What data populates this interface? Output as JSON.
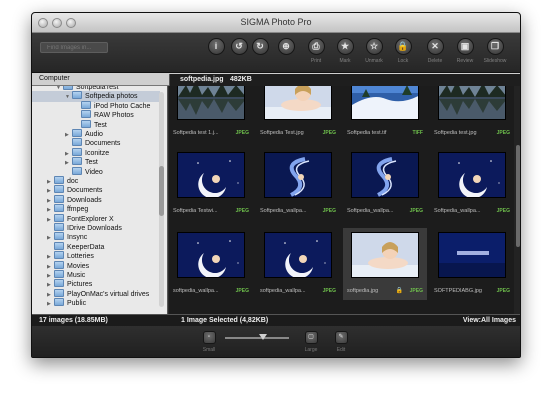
{
  "window": {
    "title": "SIGMA Photo Pro"
  },
  "toolbar": {
    "search_placeholder": "Find Images in...",
    "buttons": [
      {
        "name": "info-button",
        "glyph": "i",
        "label": ""
      },
      {
        "name": "rotate-left-button",
        "glyph": "↺",
        "label": ""
      },
      {
        "name": "rotate-right-button",
        "glyph": "↻",
        "label": ""
      },
      {
        "name": "zoom-button",
        "glyph": "⊕",
        "label": ""
      },
      {
        "name": "print-button",
        "glyph": "⎙",
        "label": "Print"
      },
      {
        "name": "mark-button",
        "glyph": "★",
        "label": "Mark"
      },
      {
        "name": "unmark-button",
        "glyph": "☆",
        "label": "Unmark"
      },
      {
        "name": "lock-button",
        "glyph": "🔒",
        "label": "Lock"
      },
      {
        "name": "delete-button",
        "glyph": "✕",
        "label": "Delete"
      },
      {
        "name": "review-button",
        "glyph": "▣",
        "label": "Review"
      },
      {
        "name": "slideshow-button",
        "glyph": "❐",
        "label": "Slideshow"
      }
    ]
  },
  "sidebar": {
    "header": "Computer",
    "items": [
      {
        "label": "SoftpediaTest",
        "level": 3,
        "arrow": "▼",
        "selected": false
      },
      {
        "label": "Softpedia photos",
        "level": 4,
        "arrow": "▼",
        "selected": true
      },
      {
        "label": "iPod Photo Cache",
        "level": 5,
        "arrow": "",
        "selected": false
      },
      {
        "label": "RAW Photos",
        "level": 5,
        "arrow": "",
        "selected": false
      },
      {
        "label": "Test",
        "level": 5,
        "arrow": "",
        "selected": false
      },
      {
        "label": "Audio",
        "level": 4,
        "arrow": "▶",
        "selected": false
      },
      {
        "label": "Documents",
        "level": 4,
        "arrow": "",
        "selected": false
      },
      {
        "label": "Iconitze",
        "level": 4,
        "arrow": "▶",
        "selected": false
      },
      {
        "label": "Test",
        "level": 4,
        "arrow": "▶",
        "selected": false
      },
      {
        "label": "Video",
        "level": 4,
        "arrow": "",
        "selected": false
      },
      {
        "label": "doc",
        "level": 2,
        "arrow": "▶",
        "selected": false
      },
      {
        "label": "Documents",
        "level": 2,
        "arrow": "▶",
        "selected": false
      },
      {
        "label": "Downloads",
        "level": 2,
        "arrow": "▶",
        "selected": false
      },
      {
        "label": "ffmpeg",
        "level": 2,
        "arrow": "▶",
        "selected": false
      },
      {
        "label": "FontExplorer X",
        "level": 2,
        "arrow": "▶",
        "selected": false
      },
      {
        "label": "IDrive Downloads",
        "level": 2,
        "arrow": "",
        "selected": false
      },
      {
        "label": "Insync",
        "level": 2,
        "arrow": "▶",
        "selected": false
      },
      {
        "label": "KeeperData",
        "level": 2,
        "arrow": "",
        "selected": false
      },
      {
        "label": "Lotteries",
        "level": 2,
        "arrow": "▶",
        "selected": false
      },
      {
        "label": "Movies",
        "level": 2,
        "arrow": "▶",
        "selected": false
      },
      {
        "label": "Music",
        "level": 2,
        "arrow": "▶",
        "selected": false
      },
      {
        "label": "Pictures",
        "level": 2,
        "arrow": "▶",
        "selected": false
      },
      {
        "label": "PlayOnMac's virtual drives",
        "level": 2,
        "arrow": "▶",
        "selected": false
      },
      {
        "label": "Public",
        "level": 2,
        "arrow": "▶",
        "selected": false
      }
    ]
  },
  "main": {
    "selected_filename": "softpedia.jpg",
    "selected_size": "482KB",
    "thumbnails": [
      {
        "caption": "Softpedia test 1.j...",
        "ext": "JPEG",
        "art": "night-lake",
        "selected": false,
        "locked": false
      },
      {
        "caption": "Softpedia Test.jpg",
        "ext": "JPEG",
        "art": "doll",
        "selected": false,
        "locked": false
      },
      {
        "caption": "Softpedia test.tif",
        "ext": "TIFF",
        "art": "snow",
        "selected": false,
        "locked": false
      },
      {
        "caption": "Softpedia test.jpg",
        "ext": "JPEG",
        "art": "night-lake",
        "selected": false,
        "locked": false
      },
      {
        "caption": "Softpedia Testwi...",
        "ext": "JPEG",
        "art": "moon",
        "selected": false,
        "locked": false
      },
      {
        "caption": "Softpedia_wallpa...",
        "ext": "JPEG",
        "art": "swirl",
        "selected": false,
        "locked": false
      },
      {
        "caption": "Softpedia_wallpa...",
        "ext": "JPEG",
        "art": "swirl",
        "selected": false,
        "locked": false
      },
      {
        "caption": "Softpedia_wallpa...",
        "ext": "JPEG",
        "art": "moon",
        "selected": false,
        "locked": false
      },
      {
        "caption": "softpedia_wallpa...",
        "ext": "JPEG",
        "art": "moon",
        "selected": false,
        "locked": false
      },
      {
        "caption": "softpedia_wallpa...",
        "ext": "JPEG",
        "art": "moon",
        "selected": false,
        "locked": false
      },
      {
        "caption": "softpedia.jpg",
        "ext": "JPEG",
        "art": "doll",
        "selected": true,
        "locked": true
      },
      {
        "caption": "SOFTPEDIABG.jpg",
        "ext": "JPEG",
        "art": "logo",
        "selected": false,
        "locked": false
      }
    ]
  },
  "status": {
    "count": "17 images (18.85MB)",
    "selection": "1 Image Selected (4,82KB)",
    "view": "View:All Images"
  },
  "bottombar": {
    "small_label": "Small",
    "large_label": "Large",
    "edit_label": "Edit",
    "thumb_size_fraction": 0.6
  }
}
